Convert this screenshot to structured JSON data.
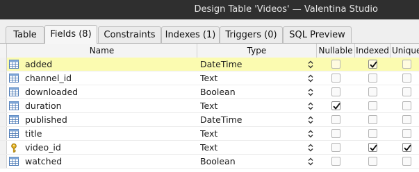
{
  "window": {
    "title": "Design Table 'Videos' — Valentina Studio"
  },
  "tabs": [
    {
      "label": "Table",
      "active": false
    },
    {
      "label": "Fields (8)",
      "active": true
    },
    {
      "label": "Constraints",
      "active": false
    },
    {
      "label": "Indexes (1)",
      "active": false
    },
    {
      "label": "Triggers (0)",
      "active": false
    },
    {
      "label": "SQL Preview",
      "active": false
    }
  ],
  "columns": {
    "name": "Name",
    "type": "Type",
    "nullable": "Nullable",
    "indexed": "Indexed",
    "unique": "Unique"
  },
  "fields": [
    {
      "name": "added",
      "type": "DateTime",
      "nullable": false,
      "indexed": true,
      "unique": false,
      "icon": "table-field-icon",
      "selected": true
    },
    {
      "name": "channel_id",
      "type": "Text",
      "nullable": false,
      "indexed": false,
      "unique": false,
      "icon": "table-field-icon",
      "selected": false
    },
    {
      "name": "downloaded",
      "type": "Boolean",
      "nullable": false,
      "indexed": false,
      "unique": false,
      "icon": "table-field-icon",
      "selected": false
    },
    {
      "name": "duration",
      "type": "Text",
      "nullable": true,
      "indexed": false,
      "unique": false,
      "icon": "table-field-icon",
      "selected": false
    },
    {
      "name": "published",
      "type": "DateTime",
      "nullable": false,
      "indexed": false,
      "unique": false,
      "icon": "table-field-icon",
      "selected": false
    },
    {
      "name": "title",
      "type": "Text",
      "nullable": false,
      "indexed": false,
      "unique": false,
      "icon": "table-field-icon",
      "selected": false
    },
    {
      "name": "video_id",
      "type": "Text",
      "nullable": false,
      "indexed": true,
      "unique": true,
      "icon": "key-icon",
      "selected": false
    },
    {
      "name": "watched",
      "type": "Boolean",
      "nullable": false,
      "indexed": false,
      "unique": false,
      "icon": "table-field-icon",
      "selected": false
    }
  ],
  "colors": {
    "titlebar": "#2f2f2f",
    "selected_row": "#fbfbb0",
    "key_icon": "#e6b31e",
    "field_icon": "#4a78b5"
  }
}
